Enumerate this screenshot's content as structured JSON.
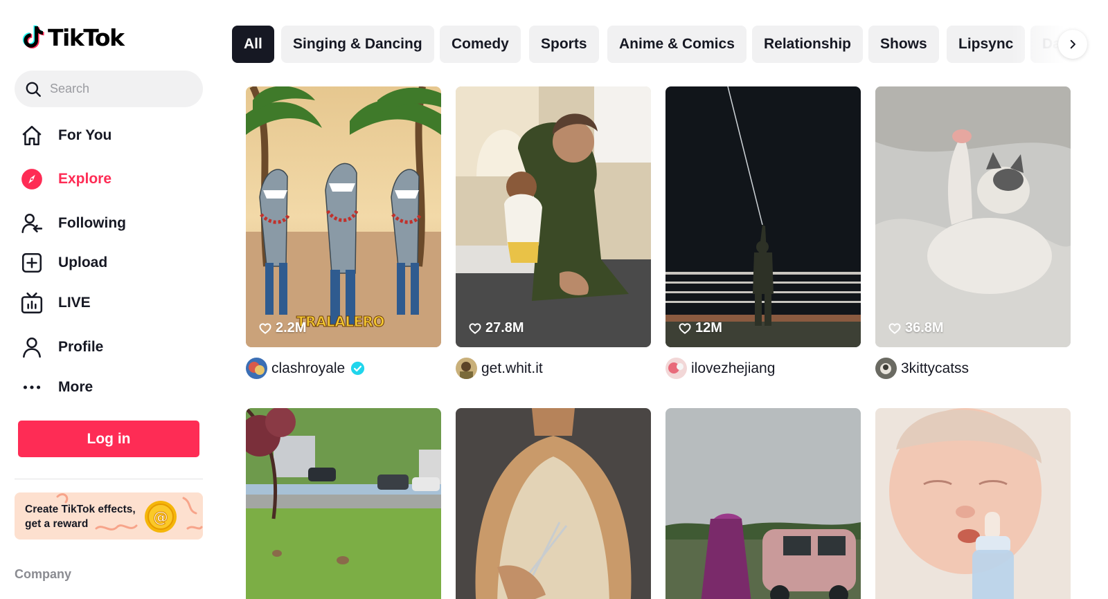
{
  "app": {
    "logo_text": "TikTok"
  },
  "search": {
    "placeholder": "Search"
  },
  "nav": {
    "for_you": "For You",
    "explore": "Explore",
    "following": "Following",
    "upload": "Upload",
    "live": "LIVE",
    "profile": "Profile",
    "more": "More"
  },
  "login": {
    "label": "Log in"
  },
  "promo": {
    "line1": "Create TikTok effects,",
    "line2": "get a reward"
  },
  "footer": {
    "company": "Company"
  },
  "categories": [
    "All",
    "Singing & Dancing",
    "Comedy",
    "Sports",
    "Anime & Comics",
    "Relationship",
    "Shows",
    "Lipsync",
    "Da"
  ],
  "categories_selected": "All",
  "videos": [
    {
      "likes": "2.2M",
      "author": "clashroyale",
      "verified": true,
      "overlay_text": "TRALALERO"
    },
    {
      "likes": "27.8M",
      "author": "get.whit.it"
    },
    {
      "likes": "12M",
      "author": "ilovezhejiang"
    },
    {
      "likes": "36.8M",
      "author": "3kittycatss"
    },
    {
      "likes": "",
      "author": ""
    },
    {
      "likes": "",
      "author": ""
    },
    {
      "likes": "",
      "author": ""
    },
    {
      "likes": "",
      "author": ""
    }
  ],
  "colors": {
    "brand": "#fe2c55",
    "text": "#161823",
    "chip_bg": "#f1f1f2",
    "verified": "#20d5ec"
  }
}
